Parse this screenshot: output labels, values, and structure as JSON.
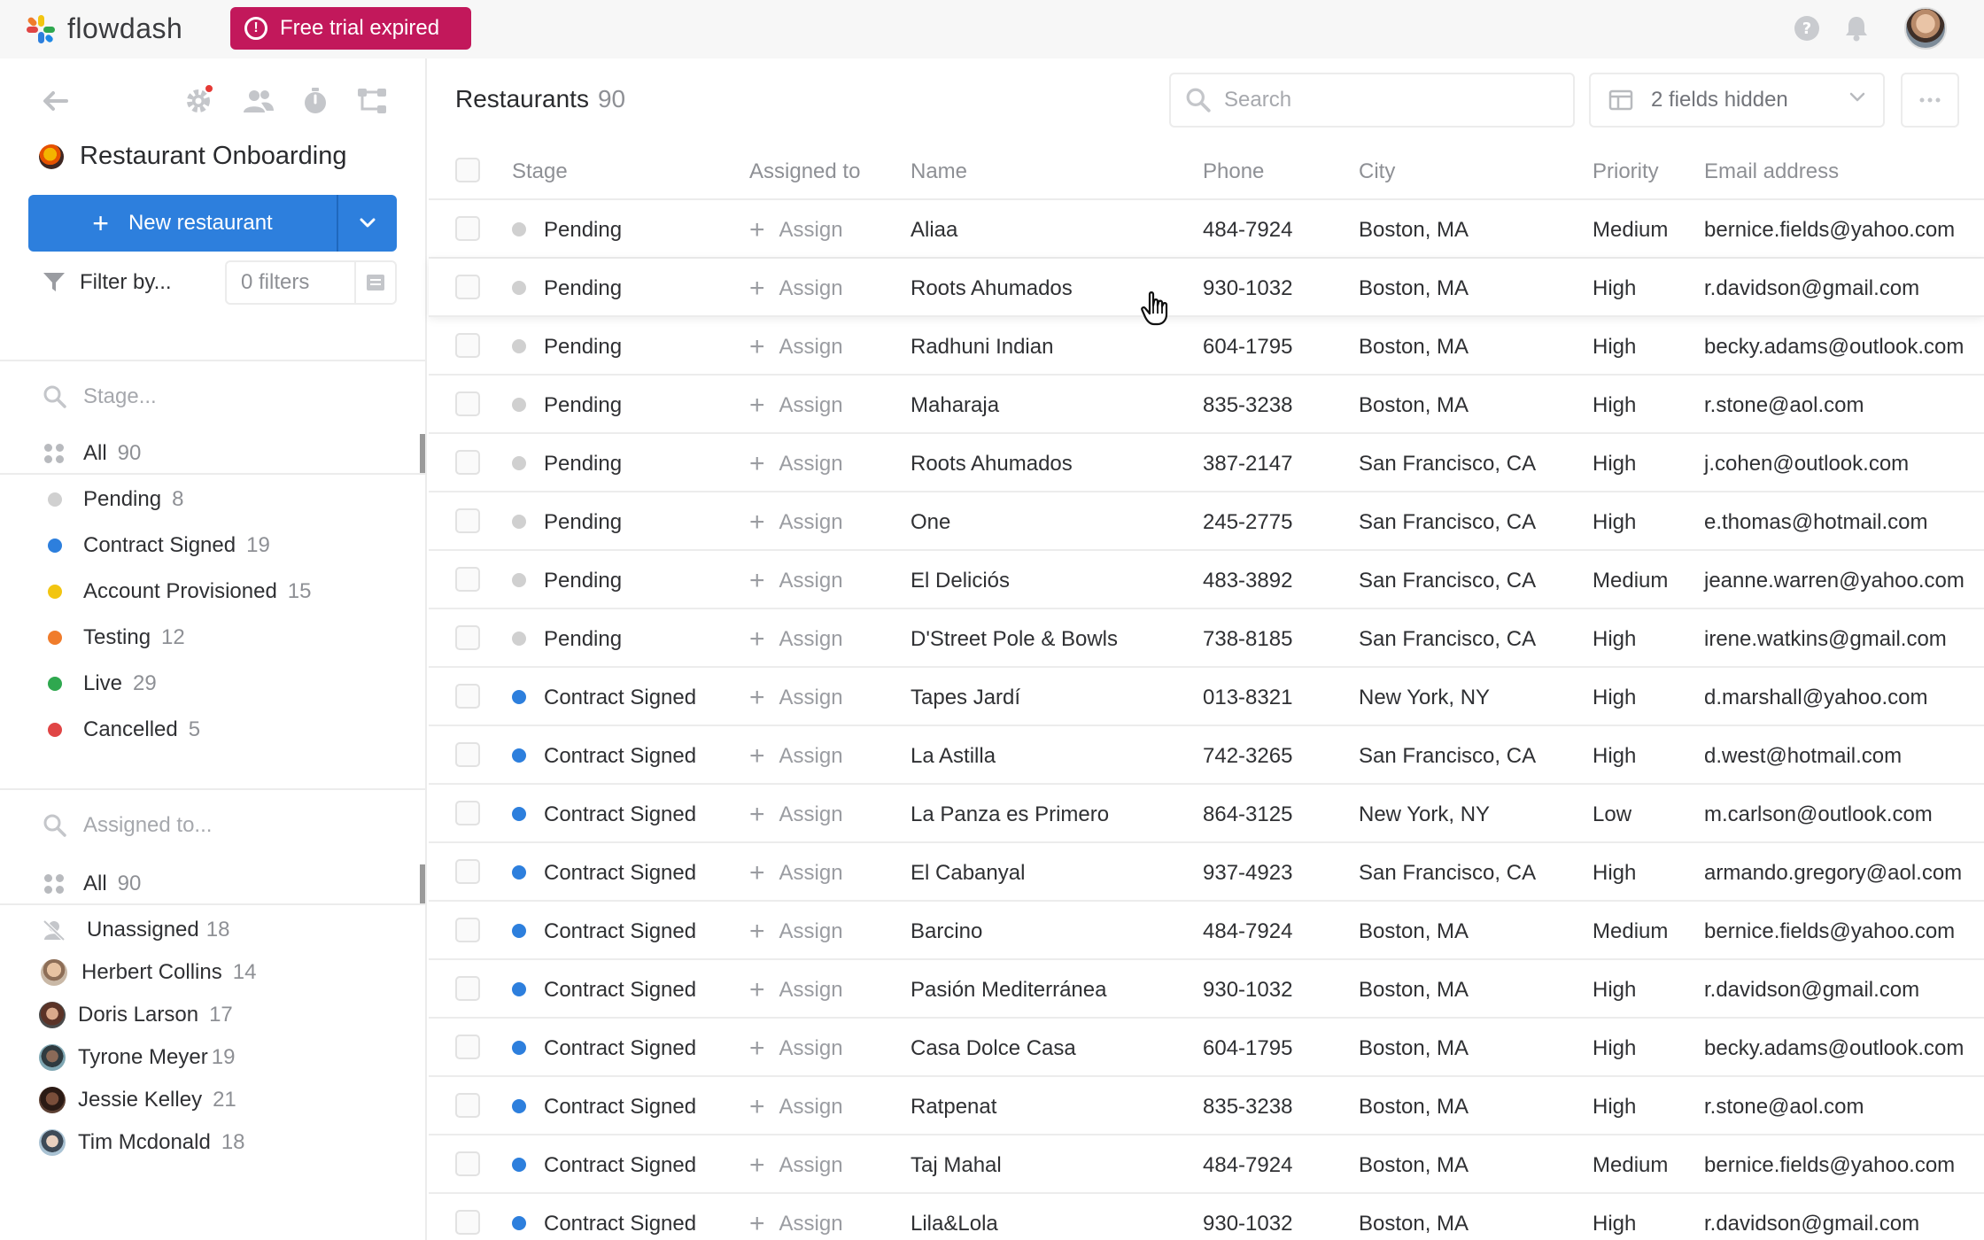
{
  "topbar": {
    "brand": "flowdash",
    "trial_badge": "Free trial expired"
  },
  "sidebar": {
    "app_title": "Restaurant Onboarding",
    "new_button": "New restaurant",
    "filter_label": "Filter by...",
    "filter_count": "0 filters",
    "stage_search_placeholder": "Stage...",
    "stages": [
      {
        "label": "All",
        "count": "90",
        "color": ""
      },
      {
        "label": "Pending",
        "count": "8",
        "color": "#d0d0d0"
      },
      {
        "label": "Contract Signed",
        "count": "19",
        "color": "#2d7fdd"
      },
      {
        "label": "Account Provisioned",
        "count": "15",
        "color": "#f2c511"
      },
      {
        "label": "Testing",
        "count": "12",
        "color": "#f07c2b"
      },
      {
        "label": "Live",
        "count": "29",
        "color": "#2fa84f"
      },
      {
        "label": "Cancelled",
        "count": "5",
        "color": "#e04545"
      }
    ],
    "assignee_search_placeholder": "Assigned to...",
    "assignees": [
      {
        "label": "All",
        "count": "90"
      },
      {
        "label": "Unassigned",
        "count": "18"
      },
      {
        "label": "Herbert Collins",
        "count": "14"
      },
      {
        "label": "Doris Larson",
        "count": "17"
      },
      {
        "label": "Tyrone Meyer",
        "count": "19"
      },
      {
        "label": "Jessie Kelley",
        "count": "21"
      },
      {
        "label": "Tim Mcdonald",
        "count": "18"
      }
    ]
  },
  "main": {
    "title": "Restaurants",
    "count": "90",
    "search_placeholder": "Search",
    "fields_hidden": "2 fields hidden",
    "columns": [
      "Stage",
      "Assigned to",
      "Name",
      "Phone",
      "City",
      "Priority",
      "Email address"
    ],
    "assign_label": "Assign",
    "rows": [
      {
        "stage": "Pending",
        "stage_color": "#d0d0d0",
        "name": "Aliaa",
        "phone": "484-7924",
        "city": "Boston, MA",
        "priority": "Medium",
        "email": "bernice.fields@yahoo.com"
      },
      {
        "stage": "Pending",
        "stage_color": "#d0d0d0",
        "name": "Roots Ahumados",
        "phone": "930-1032",
        "city": "Boston, MA",
        "priority": "High",
        "email": "r.davidson@gmail.com"
      },
      {
        "stage": "Pending",
        "stage_color": "#d0d0d0",
        "name": "Radhuni Indian",
        "phone": "604-1795",
        "city": "Boston, MA",
        "priority": "High",
        "email": "becky.adams@outlook.com"
      },
      {
        "stage": "Pending",
        "stage_color": "#d0d0d0",
        "name": "Maharaja",
        "phone": "835-3238",
        "city": "Boston, MA",
        "priority": "High",
        "email": "r.stone@aol.com"
      },
      {
        "stage": "Pending",
        "stage_color": "#d0d0d0",
        "name": "Roots Ahumados",
        "phone": "387-2147",
        "city": "San Francisco, CA",
        "priority": "High",
        "email": "j.cohen@outlook.com"
      },
      {
        "stage": "Pending",
        "stage_color": "#d0d0d0",
        "name": "One",
        "phone": "245-2775",
        "city": "San Francisco, CA",
        "priority": "High",
        "email": "e.thomas@hotmail.com"
      },
      {
        "stage": "Pending",
        "stage_color": "#d0d0d0",
        "name": "El Deliciós",
        "phone": "483-3892",
        "city": "San Francisco, CA",
        "priority": "Medium",
        "email": "jeanne.warren@yahoo.com"
      },
      {
        "stage": "Pending",
        "stage_color": "#d0d0d0",
        "name": "D'Street Pole & Bowls",
        "phone": "738-8185",
        "city": "San Francisco, CA",
        "priority": "High",
        "email": "irene.watkins@gmail.com"
      },
      {
        "stage": "Contract Signed",
        "stage_color": "#2d7fdd",
        "name": "Tapes Jardí",
        "phone": "013-8321",
        "city": "New York, NY",
        "priority": "High",
        "email": "d.marshall@yahoo.com"
      },
      {
        "stage": "Contract Signed",
        "stage_color": "#2d7fdd",
        "name": "La Astilla",
        "phone": "742-3265",
        "city": "San Francisco, CA",
        "priority": "High",
        "email": "d.west@hotmail.com"
      },
      {
        "stage": "Contract Signed",
        "stage_color": "#2d7fdd",
        "name": "La Panza es Primero",
        "phone": "864-3125",
        "city": "New York, NY",
        "priority": "Low",
        "email": "m.carlson@outlook.com"
      },
      {
        "stage": "Contract Signed",
        "stage_color": "#2d7fdd",
        "name": "El Cabanyal",
        "phone": "937-4923",
        "city": "San Francisco, CA",
        "priority": "High",
        "email": "armando.gregory@aol.com"
      },
      {
        "stage": "Contract Signed",
        "stage_color": "#2d7fdd",
        "name": "Barcino",
        "phone": "484-7924",
        "city": "Boston, MA",
        "priority": "Medium",
        "email": "bernice.fields@yahoo.com"
      },
      {
        "stage": "Contract Signed",
        "stage_color": "#2d7fdd",
        "name": "Pasión Mediterránea",
        "phone": "930-1032",
        "city": "Boston, MA",
        "priority": "High",
        "email": "r.davidson@gmail.com"
      },
      {
        "stage": "Contract Signed",
        "stage_color": "#2d7fdd",
        "name": "Casa Dolce Casa",
        "phone": "604-1795",
        "city": "Boston, MA",
        "priority": "High",
        "email": "becky.adams@outlook.com"
      },
      {
        "stage": "Contract Signed",
        "stage_color": "#2d7fdd",
        "name": "Ratpenat",
        "phone": "835-3238",
        "city": "Boston, MA",
        "priority": "High",
        "email": "r.stone@aol.com"
      },
      {
        "stage": "Contract Signed",
        "stage_color": "#2d7fdd",
        "name": "Taj Mahal",
        "phone": "484-7924",
        "city": "Boston, MA",
        "priority": "Medium",
        "email": "bernice.fields@yahoo.com"
      },
      {
        "stage": "Contract Signed",
        "stage_color": "#2d7fdd",
        "name": "Lila&Lola",
        "phone": "930-1032",
        "city": "Boston, MA",
        "priority": "High",
        "email": "r.davidson@gmail.com"
      }
    ]
  }
}
